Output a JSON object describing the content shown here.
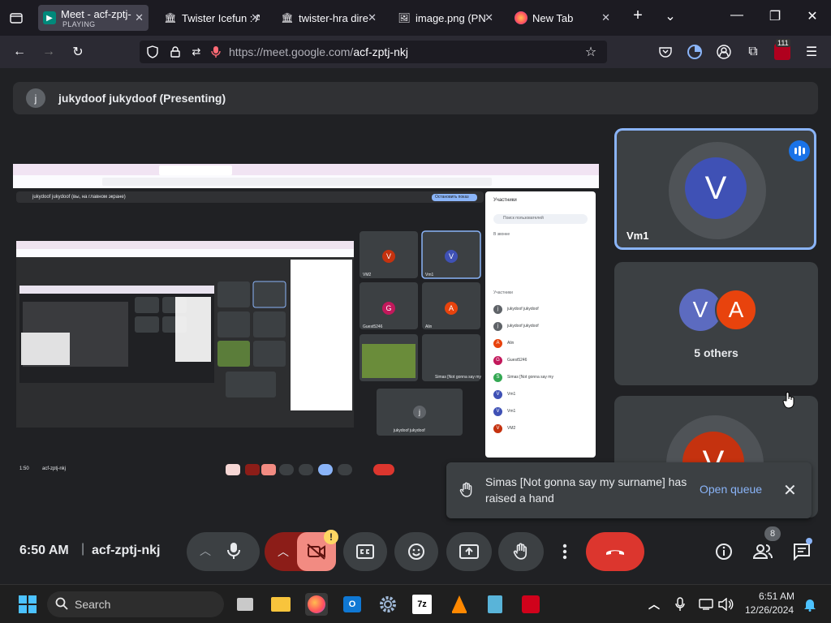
{
  "browser": {
    "tabs": [
      {
        "title": "Meet - acf-zptj-",
        "subtitle": "PLAYING",
        "icon": "meet-icon",
        "active": true
      },
      {
        "title": "Twister Icefun : A",
        "icon": "library-icon"
      },
      {
        "title": "twister-hra direc",
        "icon": "library-icon"
      },
      {
        "title": "image.png (PNG",
        "icon": "image-icon"
      },
      {
        "title": "New Tab",
        "icon": "firefox-icon"
      }
    ],
    "url_host": "https://meet.google.com/",
    "url_path": "acf-zptj-nkj",
    "extension_badge": "111"
  },
  "meet": {
    "presenter_initial": "j",
    "presenting_label": "jukydoof jukydoof (Presenting)",
    "tiles": {
      "vm1": {
        "initial": "V",
        "name": "Vm1",
        "color": "#3f51b5"
      },
      "others": {
        "initials": [
          "V",
          "A"
        ],
        "label": "5 others"
      },
      "third": {
        "initial": "V",
        "color": "#c5320f"
      }
    },
    "notification": {
      "text": "Simas [Not gonna say my surname] has raised a hand",
      "action": "Open queue"
    },
    "footer": {
      "time": "6:50 AM",
      "separator": "|",
      "code": "acf-zptj-nkj",
      "warning": "!",
      "people_count": "8"
    },
    "colors": {
      "accent": "#8ab4f8",
      "end_call": "#dc362e",
      "camera_off": "#f28b82"
    }
  },
  "shared_screen": {
    "header": "jukydoof jukydoof (вы, на главном экране)",
    "stop_button": "Остановить показ",
    "panel_title": "Участники",
    "panel_search": "Поиск пользователей",
    "panel_sub": "В звонке",
    "contributors_label": "Участники",
    "participants": [
      {
        "initial": "j",
        "name": "jukydoof jukydoof",
        "color": "#5f6368"
      },
      {
        "initial": "j",
        "name": "jukydoof jukydoof",
        "color": "#5f6368"
      },
      {
        "initial": "A",
        "name": "Alin",
        "color": "#e8430d"
      },
      {
        "initial": "G",
        "name": "Guest5246",
        "color": "#c2185b"
      },
      {
        "initial": "S",
        "name": "Simas [Not gonna say my",
        "color": "#34a853"
      },
      {
        "initial": "V",
        "name": "Vm1",
        "color": "#3f51b5"
      },
      {
        "initial": "V",
        "name": "Vm1",
        "color": "#3f51b5"
      },
      {
        "initial": "V",
        "name": "VM2",
        "color": "#c5320f"
      }
    ],
    "inner_tiles": [
      {
        "initial": "V",
        "name": "VM2",
        "color": "#c5320f"
      },
      {
        "initial": "V",
        "name": "Vm1",
        "color": "#3f51b5"
      },
      {
        "initial": "G",
        "name": "Guest5246",
        "color": "#c2185b"
      },
      {
        "initial": "A",
        "name": "Alin",
        "color": "#e8430d"
      },
      {
        "initial": "j",
        "name": "jukydoof jukydoof",
        "color": "#5f6368"
      }
    ],
    "inner_time": "1:50",
    "inner_code": "acf-zptj-nkj",
    "inner_label": "Simas [Not gonna say my"
  },
  "taskbar": {
    "search": "Search",
    "sevenzip": "7z",
    "clock_time": "6:51 AM",
    "clock_date": "12/26/2024"
  }
}
